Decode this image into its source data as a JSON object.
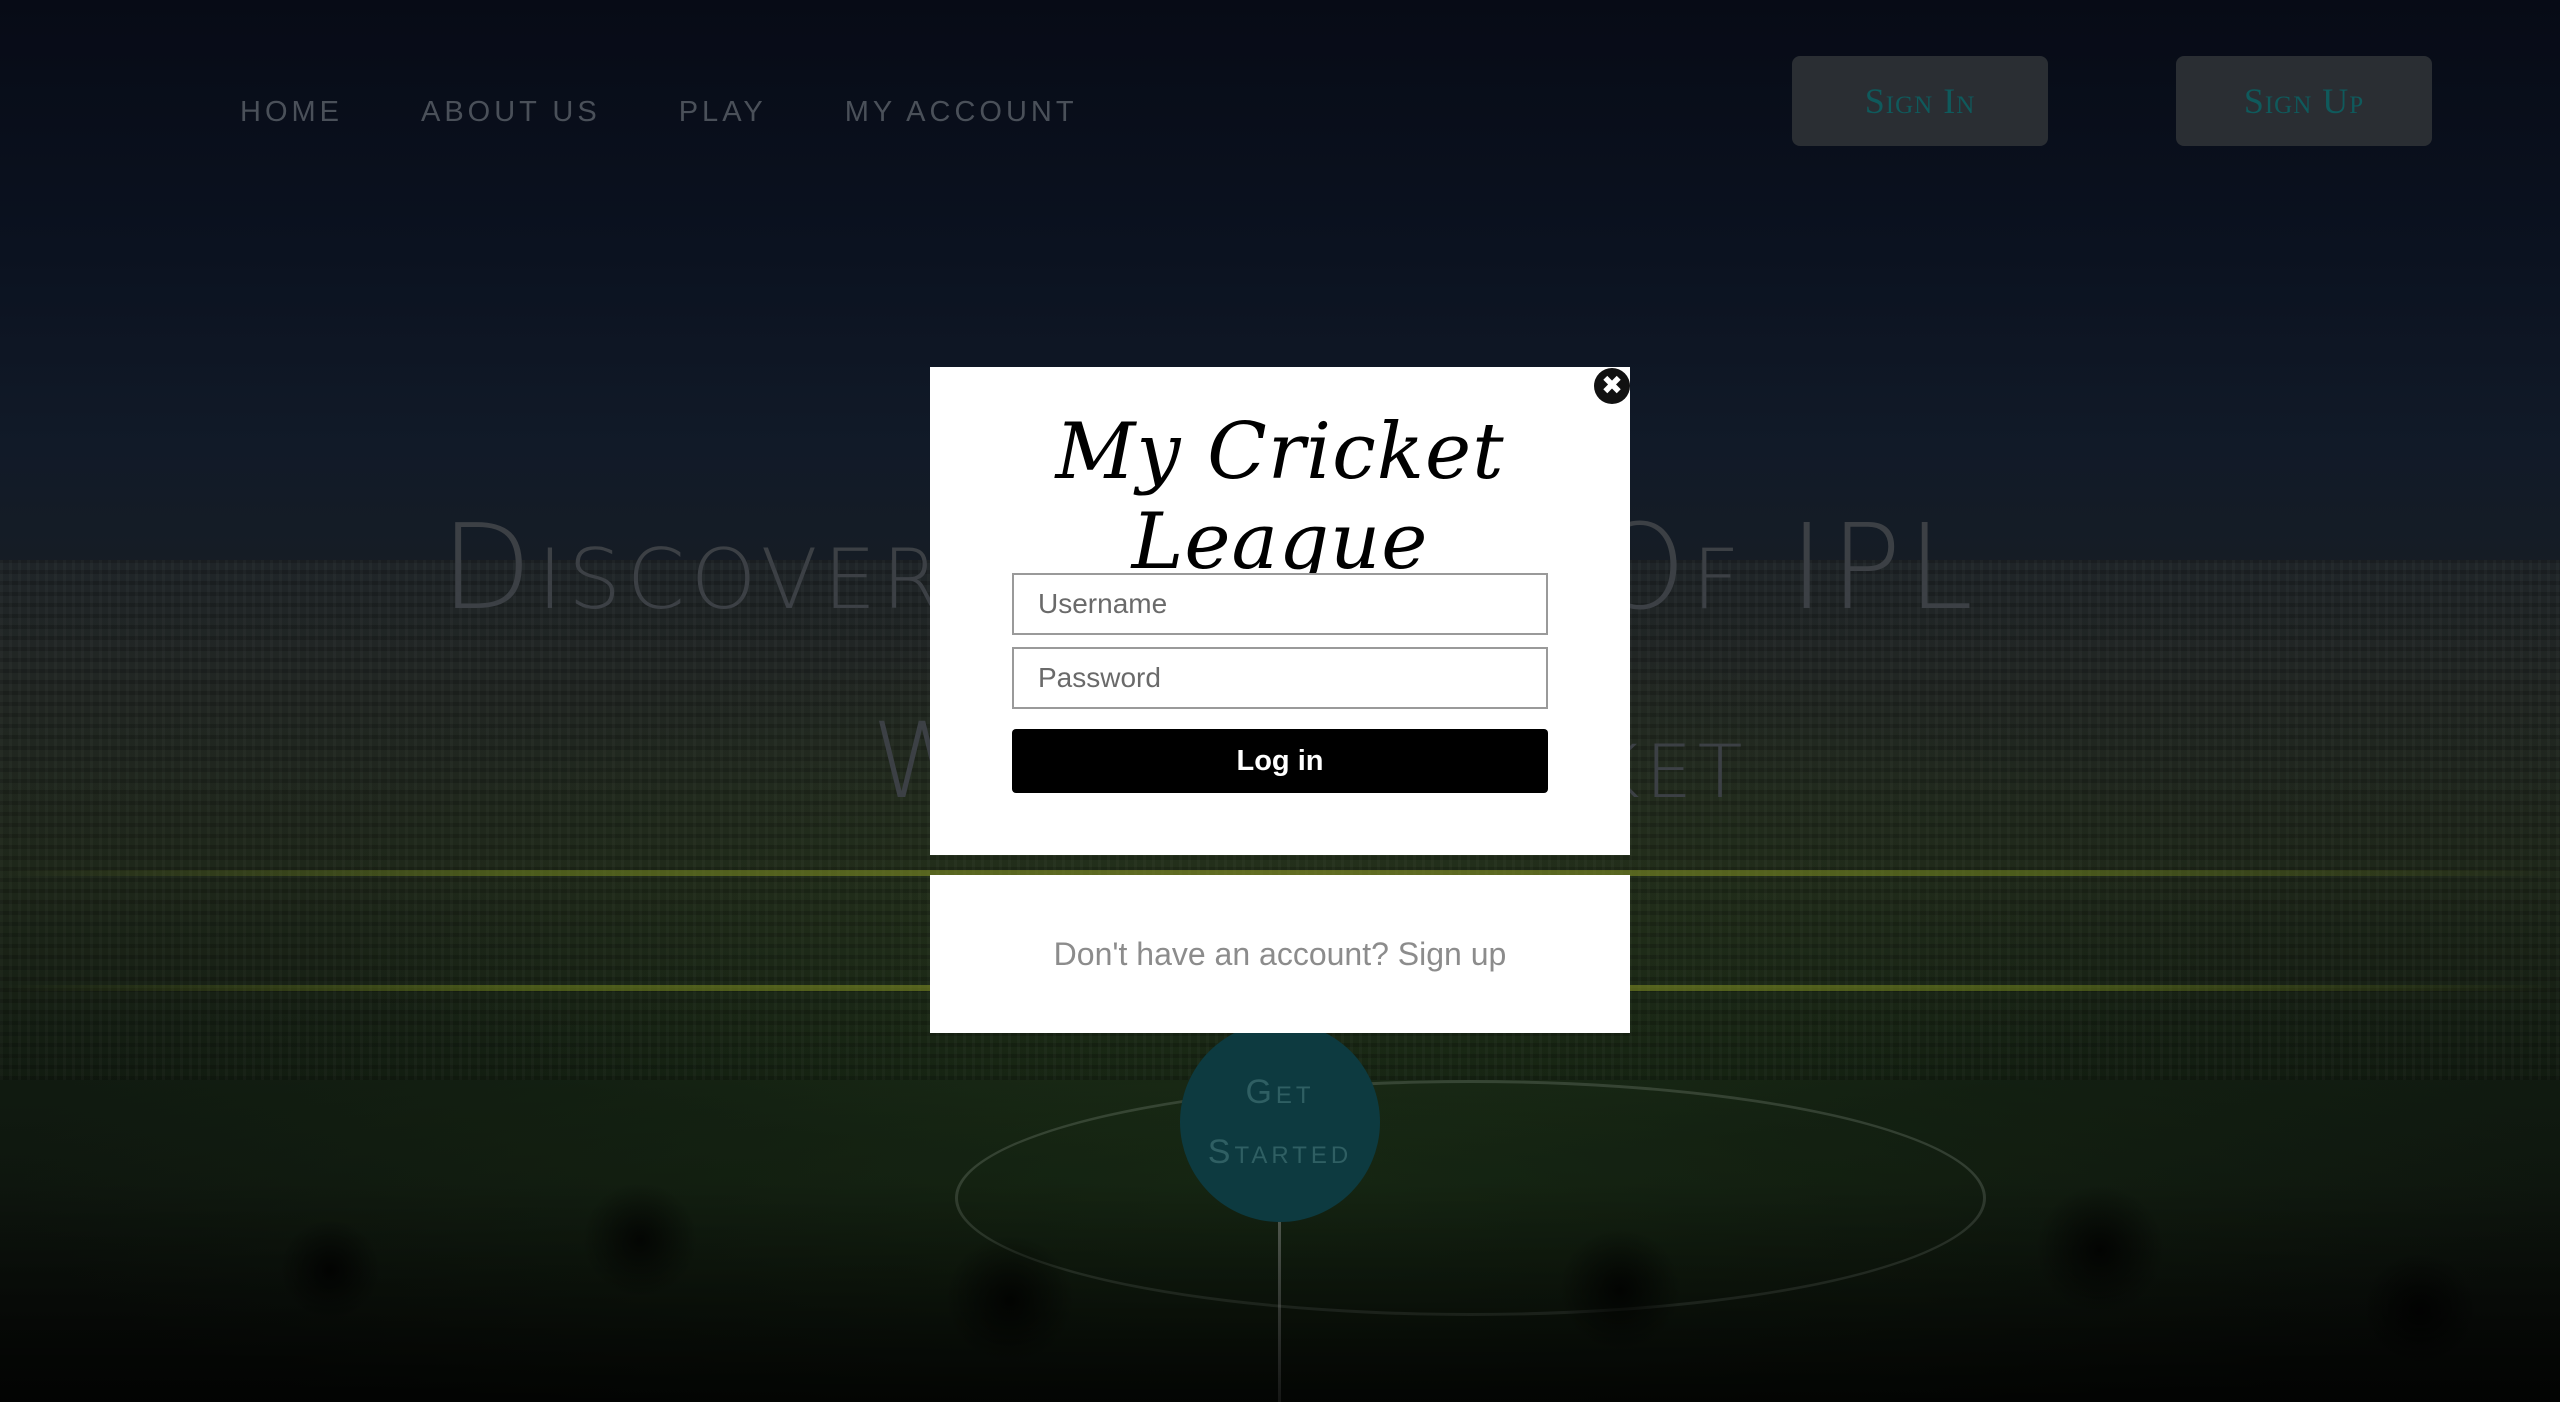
{
  "nav": {
    "items": [
      "HOME",
      "ABOUT US",
      "PLAY",
      "MY ACCOUNT"
    ],
    "sign_in": "Sign In",
    "sign_up": "Sign Up"
  },
  "hero": {
    "line1": "Discover Th",
    "line1_end": "ence Of IPL",
    "line2_start": "W",
    "line2_end": "ket",
    "get_started_1": "Get",
    "get_started_2": "Started"
  },
  "modal": {
    "title": "My Cricket League",
    "username_placeholder": "Username",
    "password_placeholder": "Password",
    "login_label": "Log in",
    "signup_prompt": "Don't have an account?",
    "signup_link": "Sign up",
    "close_symbol": "✖"
  },
  "colors": {
    "modal_bg": "#ffffff",
    "login_btn": "#000000",
    "accent_teal": "#0f5a5c"
  }
}
